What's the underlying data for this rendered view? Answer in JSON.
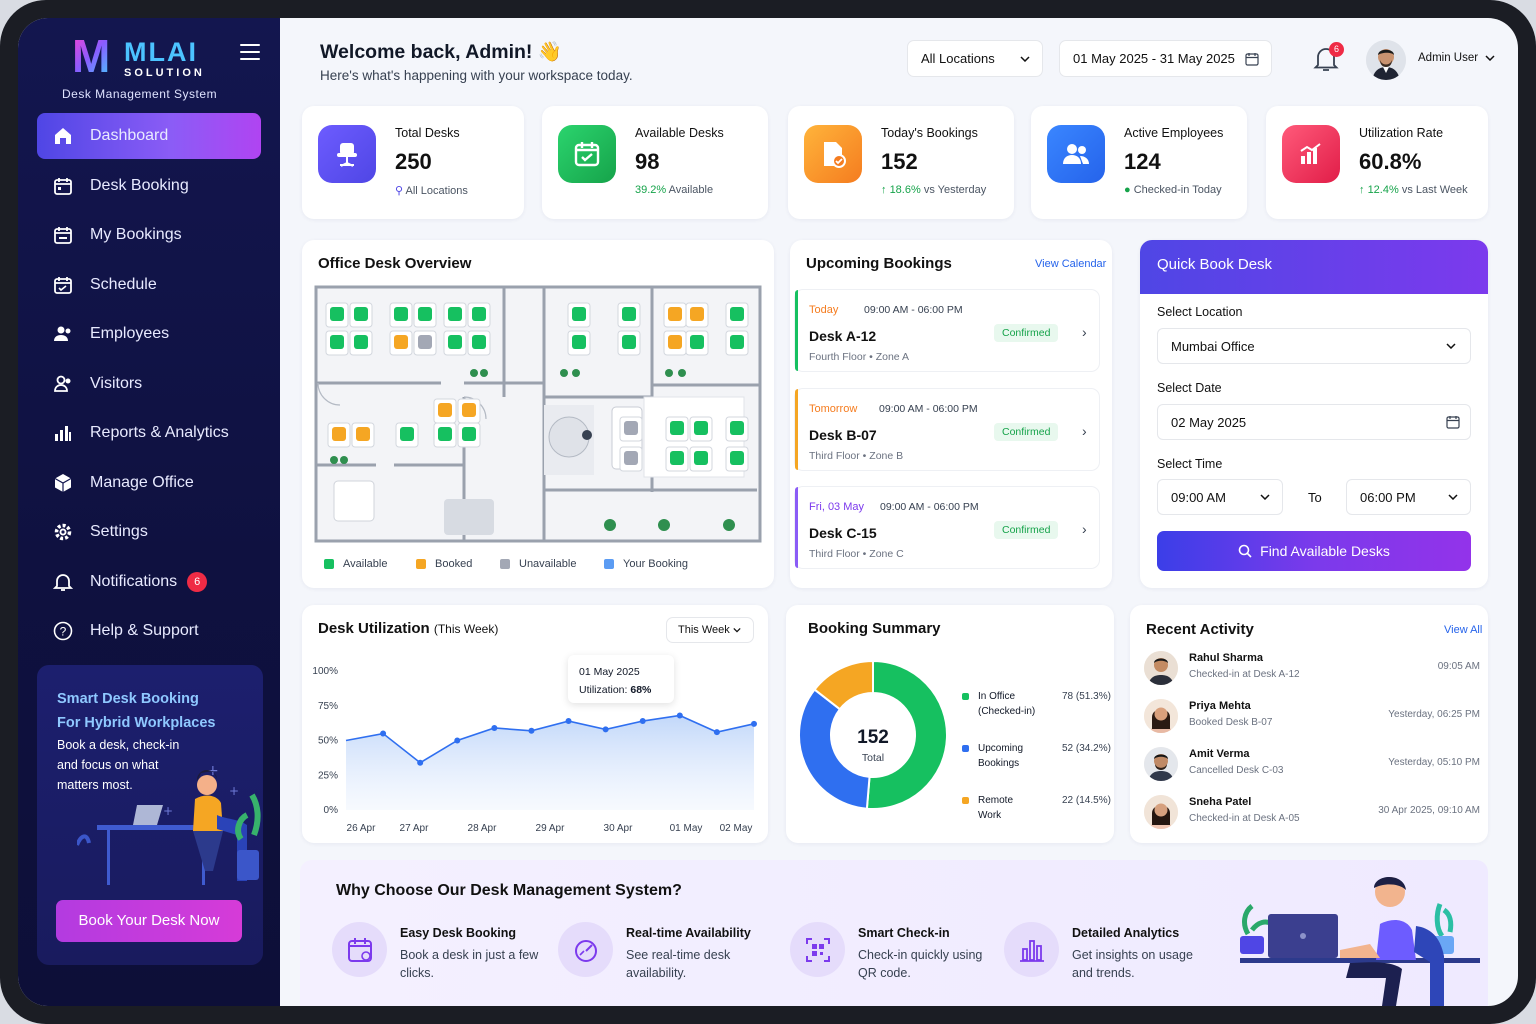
{
  "brand": {
    "logo_letter": "M",
    "name": "MLAI",
    "sub": "SOLUTION",
    "tagline": "Desk Management System"
  },
  "colors": {
    "primary": "#4f46e5",
    "accent": "#8b5cf6",
    "available": "#16c060",
    "booked": "#f5a623",
    "unavailable": "#a3a8b5",
    "your_booking": "#5b9cf3"
  },
  "sidebar": {
    "items": [
      {
        "label": "Dashboard",
        "icon": "home-icon",
        "active": true
      },
      {
        "label": "Desk Booking",
        "icon": "calendar-icon"
      },
      {
        "label": "My Bookings",
        "icon": "calendar-check-icon"
      },
      {
        "label": "Schedule",
        "icon": "calendar-icon"
      },
      {
        "label": "Employees",
        "icon": "users-icon"
      },
      {
        "label": "Visitors",
        "icon": "users-icon"
      },
      {
        "label": "Reports & Analytics",
        "icon": "bar-chart-icon"
      },
      {
        "label": "Manage Office",
        "icon": "cube-icon"
      },
      {
        "label": "Settings",
        "icon": "gear-icon"
      },
      {
        "label": "Notifications",
        "icon": "bell-icon",
        "badge": "6"
      },
      {
        "label": "Help & Support",
        "icon": "question-icon"
      }
    ],
    "promo": {
      "title_1": "Smart Desk Booking",
      "title_2": "For Hybrid Workplaces",
      "desc": "Book a desk, check-in and focus on what matters most.",
      "button": "Book Your Desk Now"
    }
  },
  "header": {
    "welcome": "Welcome back, Admin! 👋",
    "subtitle": "Here's what's happening with your workspace today.",
    "location": "All Locations",
    "date_range": "01 May 2025 - 31 May 2025",
    "notif_count": "6",
    "user": "Admin User"
  },
  "stats": [
    {
      "label": "Total Desks",
      "value": "250",
      "note": "All Locations"
    },
    {
      "label": "Available Desks",
      "value": "98",
      "note_hi": "39.2%",
      "note": "Available"
    },
    {
      "label": "Today's Bookings",
      "value": "152",
      "note_hi": "18.6%",
      "note": "vs Yesterday"
    },
    {
      "label": "Active Employees",
      "value": "124",
      "note": "Checked-in Today"
    },
    {
      "label": "Utilization Rate",
      "value": "60.8%",
      "note_hi": "12.4%",
      "note": "vs Last Week"
    }
  ],
  "overview": {
    "title": "Office Desk Overview",
    "legend": [
      "Available",
      "Booked",
      "Unavailable",
      "Your Booking"
    ]
  },
  "upcoming": {
    "title": "Upcoming Bookings",
    "link": "View Calendar",
    "items": [
      {
        "day": "Today",
        "time": "09:00 AM - 06:00 PM",
        "desk": "Desk A-12",
        "floor": "Fourth Floor",
        "zone": "Zone A",
        "status": "Confirmed"
      },
      {
        "day": "Tomorrow",
        "time": "09:00 AM - 06:00 PM",
        "desk": "Desk B-07",
        "floor": "Third Floor",
        "zone": "Zone B",
        "status": "Confirmed"
      },
      {
        "day": "Fri, 03 May",
        "time": "09:00 AM - 06:00 PM",
        "desk": "Desk C-15",
        "floor": "Third Floor",
        "zone": "Zone C",
        "status": "Confirmed"
      }
    ]
  },
  "quick_book": {
    "title": "Quick Book Desk",
    "location_label": "Select Location",
    "location": "Mumbai Office",
    "date_label": "Select Date",
    "date": "02 May 2025",
    "time_label": "Select Time",
    "from": "09:00 AM",
    "to_label": "To",
    "to": "06:00 PM",
    "button": "Find Available Desks"
  },
  "utilization": {
    "title": "Desk Utilization",
    "title_suffix": "(This Week)",
    "filter": "This Week",
    "tooltip_date": "01 May 2025",
    "tooltip_label": "Utilization:",
    "tooltip_value": "68%"
  },
  "summary": {
    "title": "Booking Summary",
    "total": "152",
    "total_label": "Total",
    "items": [
      {
        "label": "In Office",
        "label2": "(Checked-in)",
        "value": "78",
        "pct": "(51.3%)"
      },
      {
        "label": "Upcoming",
        "label2": "Bookings",
        "value": "52",
        "pct": "(34.2%)"
      },
      {
        "label": "Remote",
        "label2": "Work",
        "value": "22",
        "pct": "(14.5%)"
      }
    ]
  },
  "activity": {
    "title": "Recent Activity",
    "link": "View All",
    "items": [
      {
        "name": "Rahul Sharma",
        "desc": "Checked-in at Desk A-12",
        "time": "09:05 AM"
      },
      {
        "name": "Priya Mehta",
        "desc": "Booked Desk B-07",
        "time": "Yesterday, 06:25 PM"
      },
      {
        "name": "Amit Verma",
        "desc": "Cancelled Desk C-03",
        "time": "Yesterday, 05:10 PM"
      },
      {
        "name": "Sneha Patel",
        "desc": "Checked-in at Desk A-05",
        "time": "30 Apr 2025, 09:10 AM"
      }
    ]
  },
  "why": {
    "title": "Why Choose Our Desk Management System?",
    "features": [
      {
        "title": "Easy Desk Booking",
        "desc": "Book a desk in just a few clicks.",
        "icon": "calendar-icon"
      },
      {
        "title": "Real-time Availability",
        "desc": "See real-time desk availability.",
        "icon": "gauge-icon"
      },
      {
        "title": "Smart Check-in",
        "desc": "Check-in quickly using QR code.",
        "icon": "qr-code-icon"
      },
      {
        "title": "Detailed Analytics",
        "desc": "Get insights on usage and trends.",
        "icon": "bar-chart-icon"
      }
    ]
  },
  "chart_data": [
    {
      "type": "line",
      "title": "Desk Utilization (This Week)",
      "x": [
        "26 Apr",
        "",
        "27 Apr",
        "",
        "28 Apr",
        "",
        "29 Apr",
        "",
        "30 Apr",
        "",
        "01 May",
        "",
        "02 May"
      ],
      "categories": [
        "26 Apr",
        "27 Apr",
        "28 Apr",
        "29 Apr",
        "30 Apr",
        "01 May",
        "02 May"
      ],
      "values": [
        50,
        55,
        34,
        50,
        59,
        57,
        64,
        58,
        64,
        68,
        56,
        62
      ],
      "yticks": [
        "0%",
        "25%",
        "50%",
        "75%",
        "100%"
      ],
      "ylim": [
        0,
        100
      ],
      "grid": false
    },
    {
      "type": "pie",
      "title": "Booking Summary",
      "categories": [
        "In Office",
        "Upcoming Bookings",
        "Remote Work"
      ],
      "values": [
        78,
        52,
        22
      ],
      "colors": [
        "#16c060",
        "#2f6ff0",
        "#f5a623"
      ]
    }
  ]
}
